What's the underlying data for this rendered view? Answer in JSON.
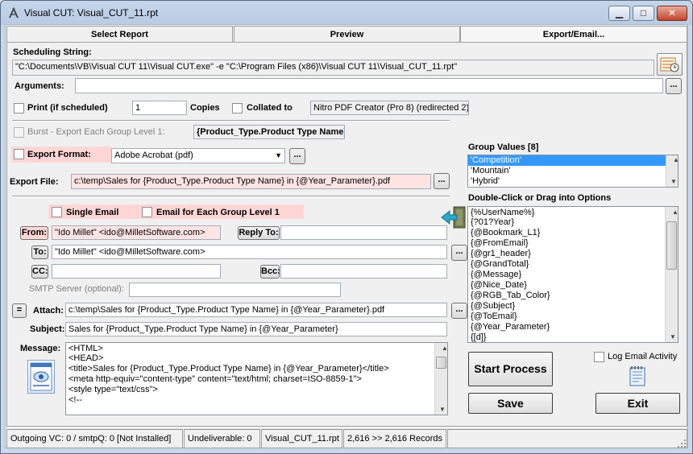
{
  "window": {
    "title": "Visual CUT:  Visual_CUT_11.rpt",
    "minimize": "▁",
    "maximize": "□",
    "close": "✕"
  },
  "tabs": [
    {
      "label": "Select Report",
      "active": false
    },
    {
      "label": "Preview",
      "active": false
    },
    {
      "label": "Export/Email...",
      "active": true
    }
  ],
  "scheduling": {
    "label": "Scheduling String:",
    "value": "\"C:\\Documents\\VB\\Visual CUT 11\\Visual CUT.exe\" -e \"C:\\Program Files (x86)\\Visual CUT 11\\Visual_CUT_11.rpt\""
  },
  "arguments": {
    "label": "Arguments:",
    "value": "",
    "button": "..."
  },
  "print": {
    "label": "Print (if scheduled)",
    "copies_value": "1",
    "copies_label": "Copies",
    "collated_label": "Collated to",
    "printer": "Nitro PDF Creator (Pro 8) (redirected 2)"
  },
  "burst": {
    "label": "Burst - Export Each Group Level 1:",
    "value": "{Product_Type.Product Type Name}"
  },
  "export_format": {
    "label": "Export Format:",
    "value": "Adobe Acrobat (pdf)",
    "button": "..."
  },
  "export_file": {
    "label": "Export File:",
    "value": "c:\\temp\\Sales for {Product_Type.Product Type Name} in {@Year_Parameter}.pdf",
    "button": "..."
  },
  "email_options": {
    "single_email": "Single Email",
    "email_each_group": "Email for Each Group Level 1"
  },
  "email": {
    "from_label": "From:",
    "from_value": "\"Ido Millet\" <ido@MilletSoftware.com>",
    "reply_to_label": "Reply To:",
    "reply_to_value": "",
    "to_label": "To:",
    "to_value": "\"Ido Millet\" <ido@MilletSoftware.com>",
    "cc_label": "CC:",
    "cc_value": "",
    "bcc_label": "Bcc:",
    "bcc_value": "",
    "smtp_label": "SMTP Server (optional):",
    "smtp_value": "",
    "equal_button": "=",
    "attach_label": "Attach:",
    "attach_value": "c:\\temp\\Sales for {Product_Type.Product Type Name} in {@Year_Parameter}.pdf",
    "subject_label": "Subject:",
    "subject_value": "Sales for {Product_Type.Product Type Name} in {@Year_Parameter}",
    "message_label": "Message:",
    "message_lines": [
      "<HTML>",
      "<HEAD>",
      "<title>Sales for {Product_Type.Product Type Name} in {@Year_Parameter}</title>",
      "<meta http-equiv=\"content-type\" content=\"text/html; charset=ISO-8859-1\">",
      "<style type=\"text/css\">",
      "<!--"
    ],
    "ellipsis": "..."
  },
  "group_values": {
    "label": "Group Values [8]",
    "items": [
      "'Competition'",
      "'Mountain'",
      "'Hybrid'"
    ],
    "selected_index": 0
  },
  "options_list": {
    "label": "Double-Click or Drag into Options",
    "items": [
      "{%UserName%}",
      "{?01?Year}",
      "{@Bookmark_L1}",
      "{@FromEmail}",
      "{@gr1_header}",
      "{@GrandTotal}",
      "{@Message}",
      "{@Nice_Date}",
      "{@RGB_Tab_Color}",
      "{@Subject}",
      "{@ToEmail}",
      "{@Year_Parameter}",
      "{[d]}"
    ]
  },
  "log_email": {
    "label": "Log Email Activity"
  },
  "buttons": {
    "start_process": "Start Process",
    "save": "Save",
    "exit": "Exit"
  },
  "status": {
    "outgoing": "Outgoing VC: 0 / smtpQ: 0 [Not Installed]",
    "undeliverable": "Undeliverable: 0",
    "report": "Visual_CUT_11.rpt",
    "records": "2,616 >> 2,616 Records"
  },
  "colors": {
    "pink_field": "#ffe4e4",
    "pink_label": "#ffd6d6",
    "selection": "#3399ff",
    "teal_arrow": "#2aa9c8"
  }
}
